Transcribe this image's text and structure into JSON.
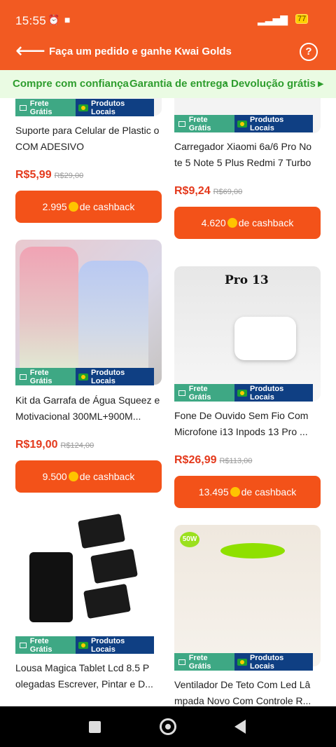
{
  "status_bar": {
    "time": "15:55",
    "battery": "77"
  },
  "header": {
    "title": "Faça um pedido e ganhe Kwai Golds",
    "help": "?"
  },
  "banner": {
    "items": [
      "Compre com confiança",
      "·",
      "Garantia de entrega",
      "·",
      "Devolução grátis"
    ]
  },
  "badges": {
    "shipping": "Frete Grátis",
    "local": "Produtos Locais"
  },
  "products": [
    {
      "name": "Suporte para Celular de Plastic o COM ADESIVO",
      "price": "R$5,99",
      "old_price": "R$29,00",
      "cashback_amount": "2.995",
      "cashback_label": "de cashback"
    },
    {
      "name": "Carregador Xiaomi 6a/6 Pro No te 5 Note 5 Plus Redmi 7 Turbo",
      "price": "R$9,24",
      "old_price": "R$69,00",
      "cashback_amount": "4.620",
      "cashback_label": "de cashback"
    },
    {
      "name": "Kit da Garrafa de Água Squeez e Motivacional 300ML+900M...",
      "price": "R$19,00",
      "old_price": "R$124,00",
      "cashback_amount": "9.500",
      "cashback_label": "de cashback"
    },
    {
      "name": "Fone De Ouvido Sem Fio Com Microfone i13 Inpods 13 Pro ...",
      "price": "R$26,99",
      "old_price": "R$113,00",
      "cashback_amount": "13.495",
      "cashback_label": "de cashback",
      "image_text": "Pro 13"
    },
    {
      "name": "Lousa Magica Tablet Lcd 8.5 P olegadas Escrever, Pintar e D...",
      "price": "",
      "old_price": ""
    },
    {
      "name": "Ventilador De Teto Com Led Lâ mpada Novo Com Controle R...",
      "price": "",
      "old_price": "",
      "image_text": "50W"
    }
  ]
}
